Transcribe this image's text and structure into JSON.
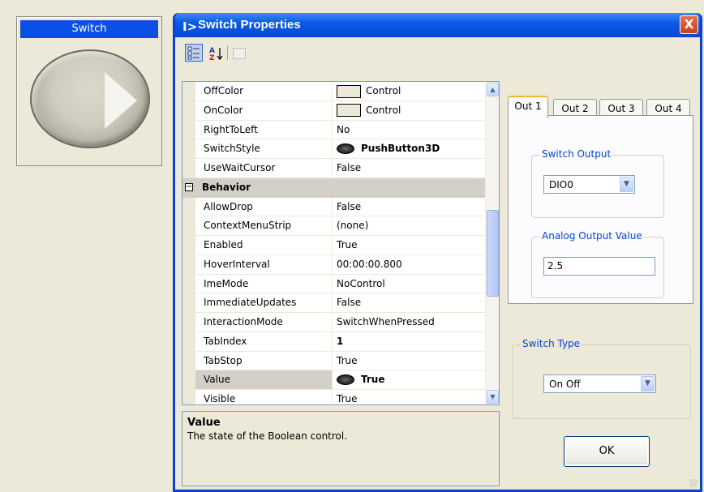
{
  "switch_panel": {
    "caption": "Switch"
  },
  "dialog": {
    "title_icon": "I>",
    "title": "Switch Properties",
    "close_label": "X"
  },
  "toolbar": {
    "categorized_icon": "categorized-icon",
    "sort_icon": "A↓Z",
    "pages_icon": "property-pages-icon"
  },
  "grid": {
    "rows": [
      {
        "name": "OffColor",
        "value": "Control",
        "kind": "color"
      },
      {
        "name": "OnColor",
        "value": "Control",
        "kind": "color"
      },
      {
        "name": "RightToLeft",
        "value": "No"
      },
      {
        "name": "SwitchStyle",
        "value": "PushButton3D",
        "kind": "switch",
        "bold": true
      },
      {
        "name": "UseWaitCursor",
        "value": "False"
      },
      {
        "category": "Behavior"
      },
      {
        "name": "AllowDrop",
        "value": "False"
      },
      {
        "name": "ContextMenuStrip",
        "value": "(none)"
      },
      {
        "name": "Enabled",
        "value": "True"
      },
      {
        "name": "HoverInterval",
        "value": "00:00:00.800"
      },
      {
        "name": "ImeMode",
        "value": "NoControl"
      },
      {
        "name": "ImmediateUpdates",
        "value": "False"
      },
      {
        "name": "InteractionMode",
        "value": "SwitchWhenPressed"
      },
      {
        "name": "TabIndex",
        "value": "1",
        "bold": true
      },
      {
        "name": "TabStop",
        "value": "True"
      },
      {
        "name": "Value",
        "value": "True",
        "kind": "switch",
        "bold": true,
        "selected": true
      },
      {
        "name": "Visible",
        "value": "True"
      }
    ],
    "expander_symbol": "−"
  },
  "description": {
    "title": "Value",
    "text": "The state of the Boolean control."
  },
  "tabs": [
    {
      "label": "Out 1",
      "active": true
    },
    {
      "label": "Out 2"
    },
    {
      "label": "Out 3"
    },
    {
      "label": "Out 4"
    }
  ],
  "switch_output": {
    "legend": "Switch Output",
    "value": "DIO0"
  },
  "analog_output": {
    "legend": "Analog Output Value",
    "value": "2.5"
  },
  "switch_type": {
    "legend": "Switch Type",
    "value": "On Off"
  },
  "ok_label": "OK",
  "colors": {
    "title_bar": "#0c5ae6",
    "caption_bar": "#0a50e6",
    "legend_text": "#0046d5",
    "active_tab_accent": "#f0b62b"
  }
}
